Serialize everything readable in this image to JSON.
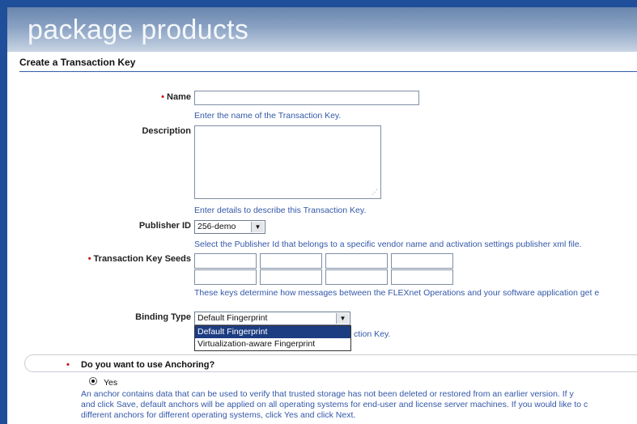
{
  "banner": {
    "title": "package products"
  },
  "section": {
    "title": "Create a Transaction Key"
  },
  "form": {
    "name": {
      "label": "Name",
      "required": "•",
      "value": "",
      "hint": "Enter the name of the Transaction Key."
    },
    "description": {
      "label": "Description",
      "value": "",
      "hint": "Enter details to describe this Transaction Key."
    },
    "publisher": {
      "label": "Publisher ID",
      "selected": "256-demo",
      "hint": "Select the Publisher Id that belongs to a specific vendor name and activation settings publisher xml file."
    },
    "seeds": {
      "label": "Transaction Key Seeds",
      "required": "•",
      "hint": "These keys determine how messages between the FLEXnet Operations and your software application get e"
    },
    "binding": {
      "label": "Binding Type",
      "selected": "Default Fingerprint",
      "options": [
        "Default Fingerprint",
        "Virtualization-aware Fingerprint"
      ],
      "hint_tail": "ction Key."
    }
  },
  "anchoring": {
    "required": "•",
    "question": "Do you want to use Anchoring?",
    "yes_label": "Yes",
    "description": [
      "An anchor contains data that can be used to verify that trusted storage has not been deleted or restored from an earlier version. If y",
      "and click Save, default anchors will be applied on all operating systems for end-user and license server machines. If you would like to c",
      "different anchors for different operating systems, click Yes and click Next."
    ]
  },
  "colors": {
    "accent": "#1f4f9a",
    "hint": "#3358a8",
    "required": "#cc1111"
  }
}
